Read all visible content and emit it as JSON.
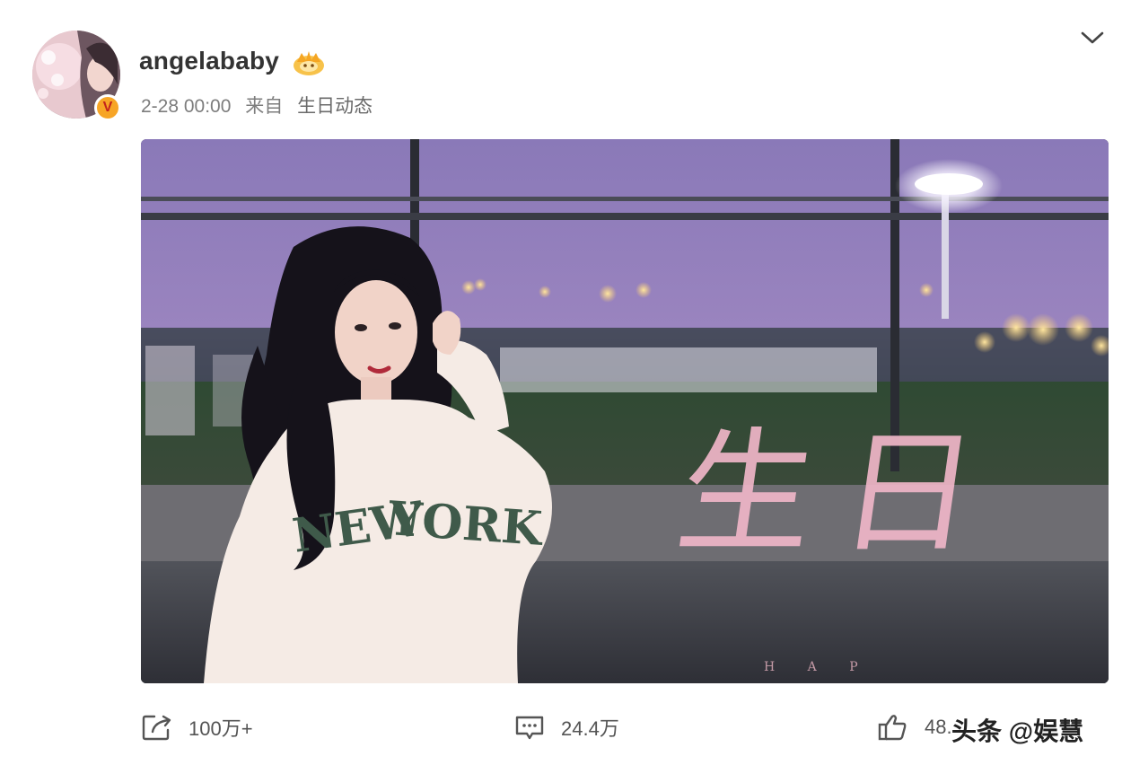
{
  "post": {
    "username": "angelababy",
    "time": "2-28 00:00",
    "source_prefix": "来自",
    "source": "生日动态",
    "image": {
      "calligraphy": "生日",
      "small_text": "H A P",
      "shirt_text": "NEW YORK"
    }
  },
  "actions": {
    "repost_count": "100万+",
    "comment_count": "24.4万",
    "like_count": "48."
  },
  "watermark": "头条 @娱慧",
  "icons": {
    "more": "chevron-down-icon",
    "repost": "share-icon",
    "comment": "comment-icon",
    "like": "thumbs-up-icon",
    "badge": "crown-badge-icon",
    "verified": "verified-v-icon"
  },
  "colors": {
    "text_primary": "#333333",
    "text_secondary": "#7d7d7d",
    "badge_gold": "#f7a526",
    "verified_red": "#c3231c"
  }
}
